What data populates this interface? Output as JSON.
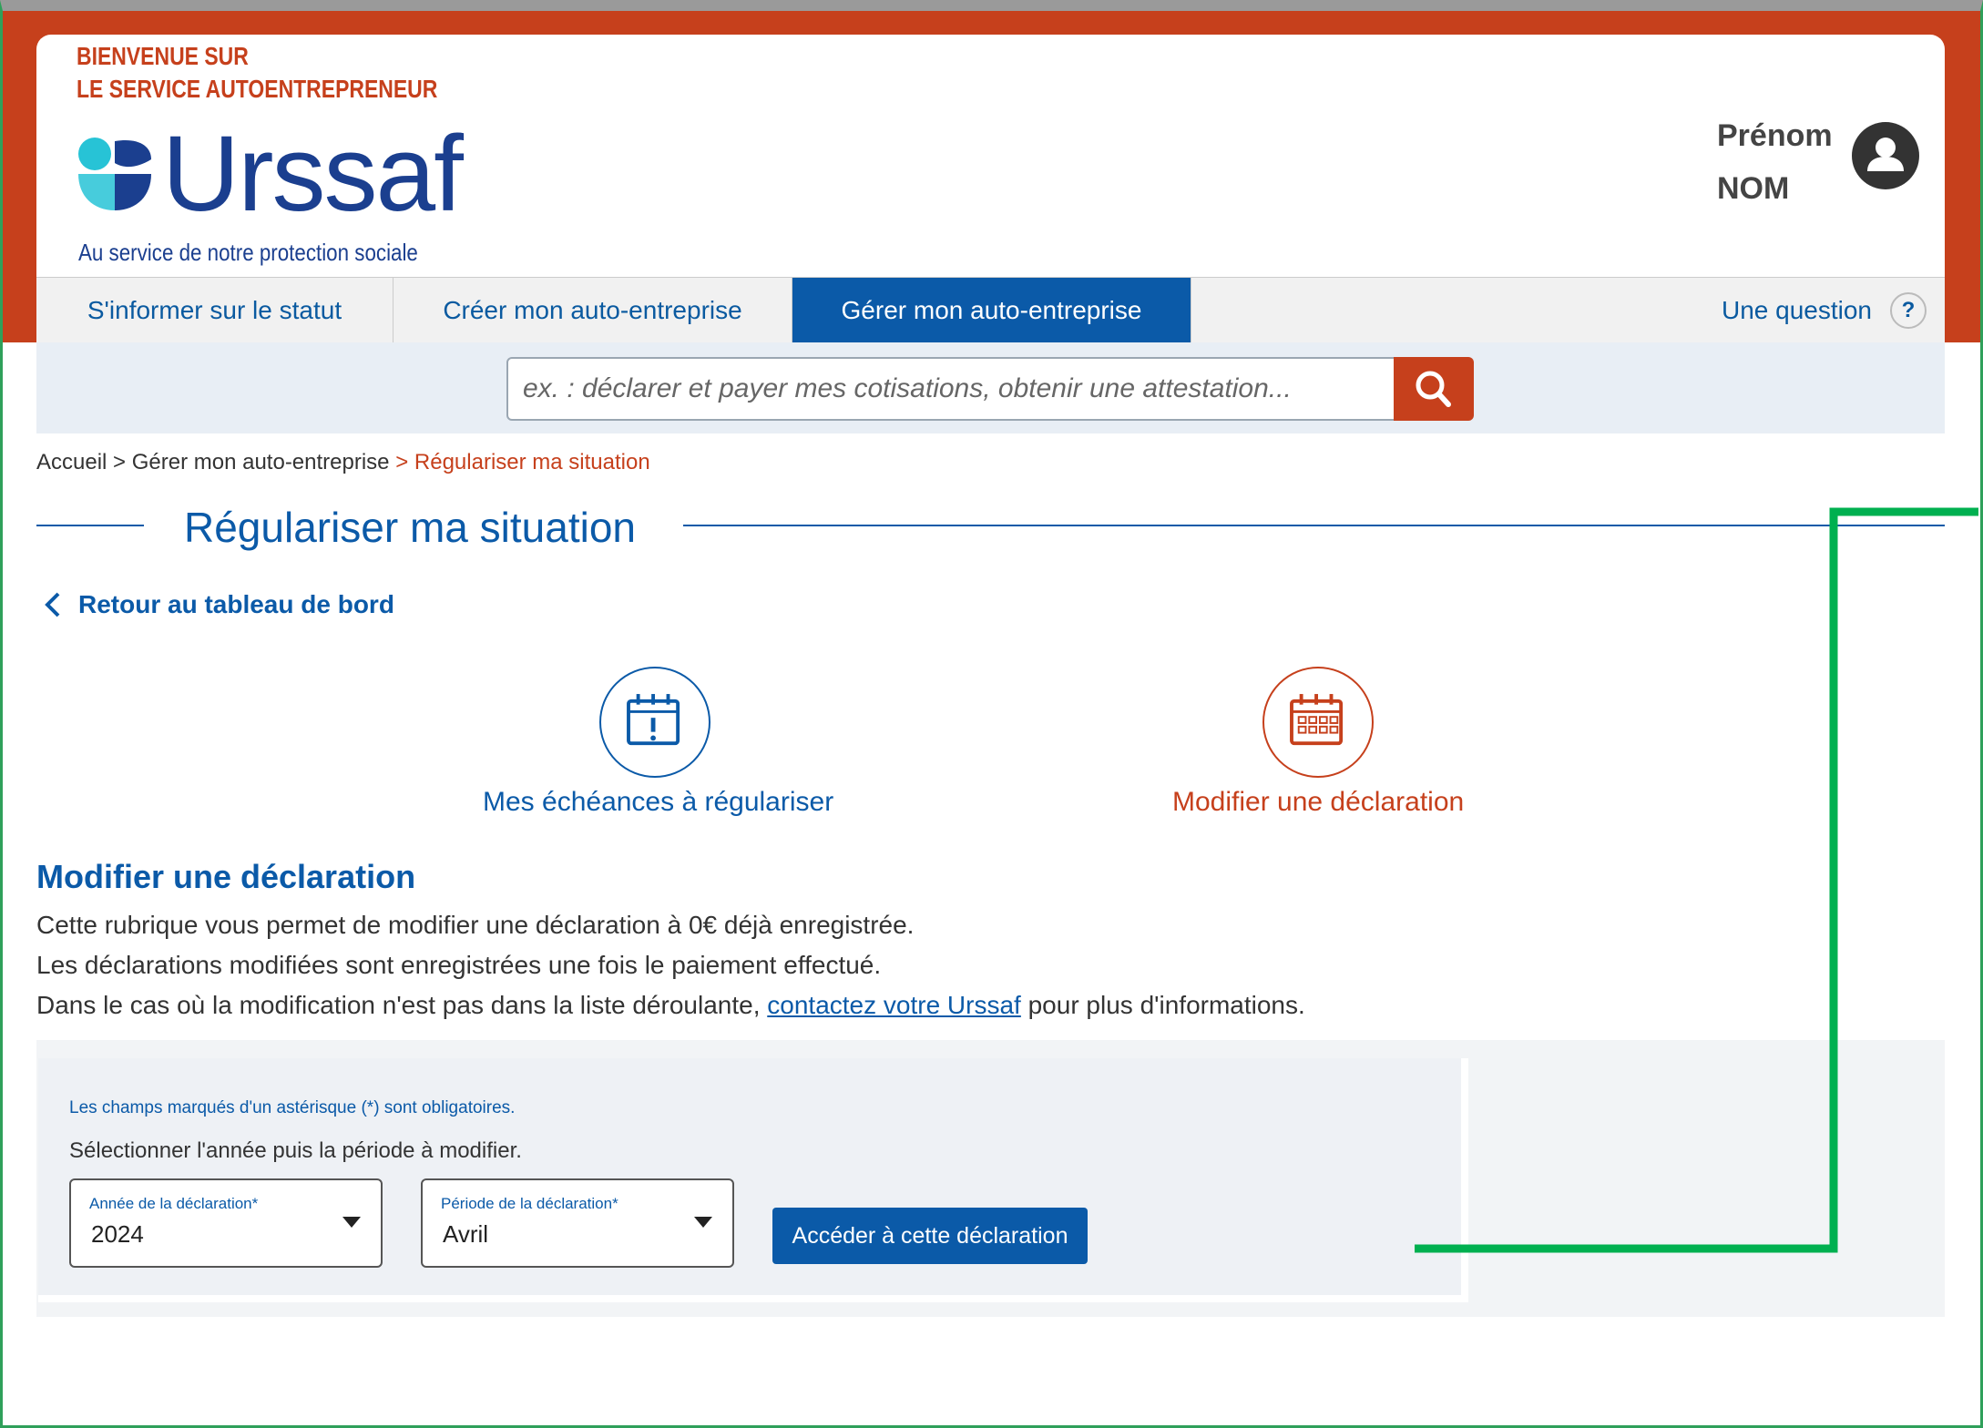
{
  "header": {
    "welcome_line1": "BIENVENUE SUR",
    "welcome_line2": "LE SERVICE AUTOENTREPRENEUR",
    "logo_text": "Urssaf",
    "tagline": "Au service de notre protection sociale",
    "user_first": "Prénom",
    "user_last": "NOM",
    "brand_color": "#c6401c",
    "accent_color": "#0b5aa8"
  },
  "nav": {
    "tabs": [
      {
        "label": "S'informer sur le statut",
        "active": false
      },
      {
        "label": "Créer mon auto-entreprise",
        "active": false
      },
      {
        "label": "Gérer mon auto-entreprise",
        "active": true
      }
    ],
    "question_label": "Une question",
    "question_icon": "?"
  },
  "search": {
    "placeholder": "ex. : déclarer et payer mes cotisations, obtenir une attestation...",
    "icon": "search-icon"
  },
  "breadcrumb": {
    "home": "Accueil",
    "sep": ">",
    "parent": "Gérer mon auto-entreprise",
    "current": "Régulariser ma situation"
  },
  "page": {
    "title": "Régulariser ma situation",
    "back_label": "Retour au tableau de bord"
  },
  "actions": [
    {
      "label": "Mes échéances à régulariser",
      "icon": "calendar-alert-icon",
      "color": "#0b5aa8"
    },
    {
      "label": "Modifier une déclaration",
      "icon": "calendar-grid-icon",
      "color": "#c6401c"
    }
  ],
  "section": {
    "title": "Modifier une déclaration",
    "line1": "Cette rubrique vous permet de modifier une déclaration à 0€ déjà enregistrée.",
    "line2": "Les déclarations modifiées sont enregistrées une fois le paiement effectué.",
    "line3_before": "Dans le cas où la modification n'est pas dans la liste déroulante, ",
    "line3_link": "contactez votre Urssaf",
    "line3_after": " pour plus d'informations."
  },
  "form": {
    "required_note": "Les champs marqués d'un astérisque (*) sont obligatoires.",
    "instruction": "Sélectionner l'année puis la période à modifier.",
    "year_label": "Année de la déclaration*",
    "year_value": "2024",
    "period_label": "Période de la déclaration*",
    "period_value": "Avril",
    "submit_label": "Accéder à cette déclaration"
  }
}
